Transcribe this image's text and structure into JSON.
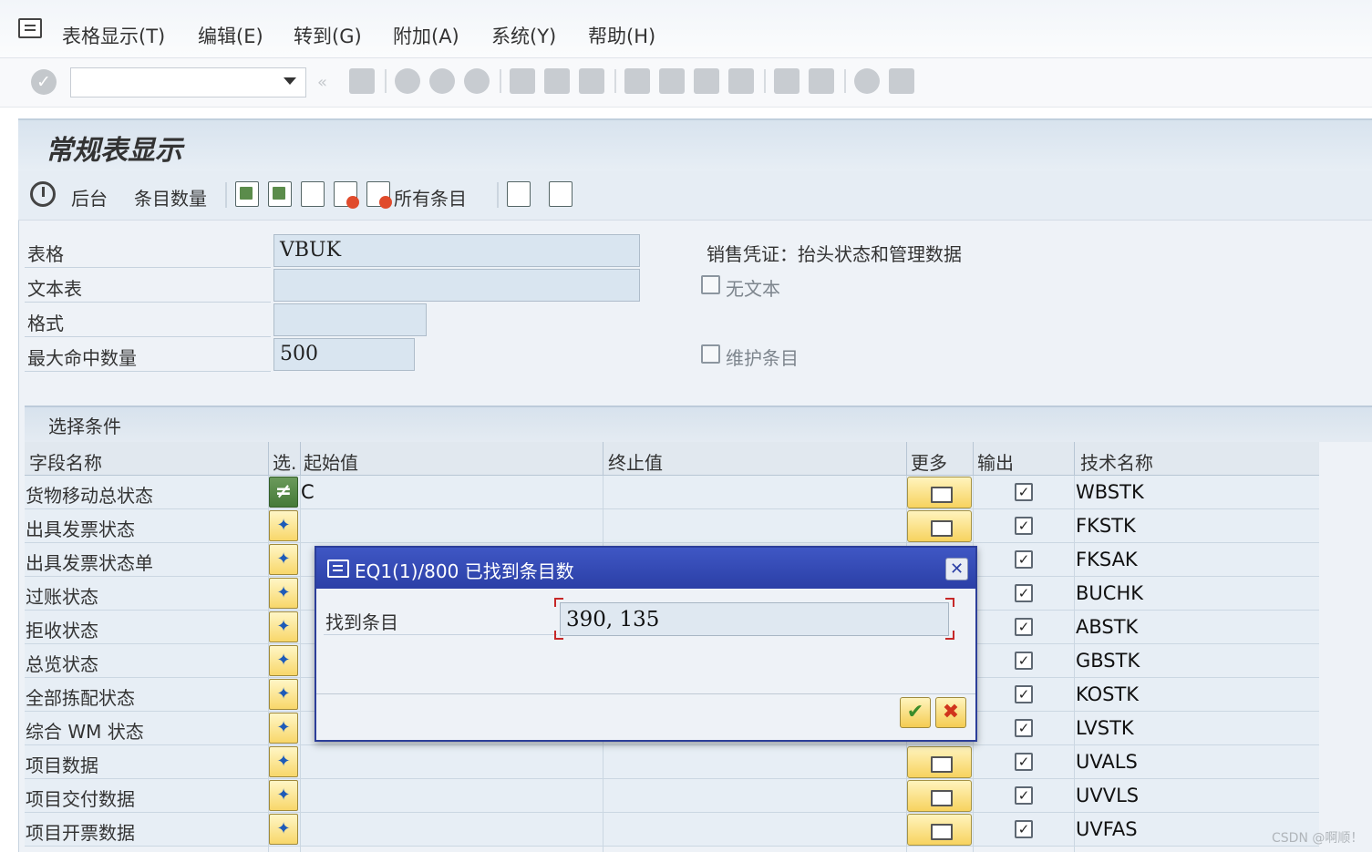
{
  "menubar": {
    "items": [
      "表格显示(T)",
      "编辑(E)",
      "转到(G)",
      "附加(A)",
      "系统(Y)",
      "帮助(H)"
    ]
  },
  "toolbar": {
    "command_field": "",
    "icons": [
      "enter-icon",
      "back-icon",
      "save-icon",
      "back-nav-icon",
      "exit-icon",
      "cancel-icon",
      "print-icon",
      "find-icon",
      "find-next-icon",
      "first-page-icon",
      "prev-page-icon",
      "next-page-icon",
      "last-page-icon",
      "new-session-icon",
      "shortcut-icon",
      "help-icon",
      "layout-icon"
    ]
  },
  "page": {
    "title": "常规表显示"
  },
  "app_toolbar": {
    "background_label": "后台",
    "count_label": "条目数量",
    "all_entries_label": "所有条目"
  },
  "fields": {
    "table_label": "表格",
    "table_value": "VBUK",
    "text_table_label": "文本表",
    "text_table_value": "",
    "format_label": "格式",
    "format_value": "",
    "max_hits_label": "最大命中数量",
    "max_hits_value": "500",
    "table_description": "销售凭证：抬头状态和管理数据",
    "no_text_label": "无文本",
    "maintain_entries_label": "维护条目"
  },
  "selection": {
    "title": "选择条件",
    "columns": [
      "字段名称",
      "选.",
      "起始值",
      "终止值",
      "更多",
      "输出",
      "技术名称"
    ],
    "rows": [
      {
        "name": "货物移动总状态",
        "start": "C",
        "tech": "WBSTK"
      },
      {
        "name": "出具发票状态",
        "start": "",
        "tech": "FKSTK"
      },
      {
        "name": "出具发票状态单",
        "start": "",
        "tech": "FKSAK"
      },
      {
        "name": "过账状态",
        "start": "",
        "tech": "BUCHK"
      },
      {
        "name": "拒收状态",
        "start": "",
        "tech": "ABSTK"
      },
      {
        "name": "总览状态",
        "start": "",
        "tech": "GBSTK"
      },
      {
        "name": "全部拣配状态",
        "start": "",
        "tech": "KOSTK"
      },
      {
        "name": "综合 WM 状态",
        "start": "",
        "tech": "LVSTK"
      },
      {
        "name": "项目数据",
        "start": "",
        "tech": "UVALS"
      },
      {
        "name": "项目交付数据",
        "start": "",
        "tech": "UVVLS"
      },
      {
        "name": "项目开票数据",
        "start": "",
        "tech": "UVFAS"
      }
    ]
  },
  "dialog": {
    "title": "EQ1(1)/800 已找到条目数",
    "label": "找到条目",
    "value": "390, 135"
  },
  "watermark": "CSDN @啊顺！",
  "colors": {
    "dialog_title": "#2b3fa6",
    "option_button": "#f8d76a",
    "focus_corner": "#c62828"
  }
}
